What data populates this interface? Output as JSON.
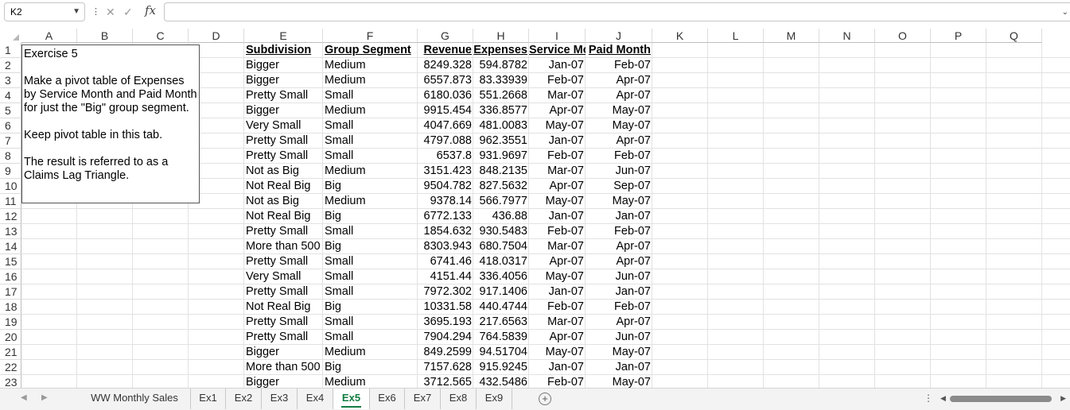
{
  "formula_bar": {
    "name_box": "K2",
    "formula": ""
  },
  "columns": [
    "A",
    "B",
    "C",
    "D",
    "E",
    "F",
    "G",
    "H",
    "I",
    "J",
    "K",
    "L",
    "M",
    "N",
    "O",
    "P",
    "Q"
  ],
  "row_numbers": [
    "1",
    "2",
    "3",
    "4",
    "5",
    "6",
    "7",
    "8",
    "9",
    "10",
    "11",
    "12",
    "13",
    "14",
    "15",
    "16",
    "17",
    "18",
    "19",
    "20",
    "21",
    "22",
    "23"
  ],
  "text_box": {
    "lines": [
      "Exercise 5",
      "",
      "Make a pivot table of Expenses",
      "by Service Month and Paid Month",
      "for just the \"Big\" group segment.",
      "",
      "Keep pivot table in this tab.",
      "",
      "The result is referred to as a",
      "Claims Lag Triangle."
    ]
  },
  "table": {
    "headers": [
      "Subdivision",
      "Group Segment",
      "Revenue",
      "Expenses",
      "Service Month",
      "Paid Month"
    ],
    "rows": [
      [
        "Bigger",
        "Medium",
        "8249.328",
        "594.8782",
        "Jan-07",
        "Feb-07"
      ],
      [
        "Bigger",
        "Medium",
        "6557.873",
        "83.33939",
        "Feb-07",
        "Apr-07"
      ],
      [
        "Pretty Small",
        "Small",
        "6180.036",
        "551.2668",
        "Mar-07",
        "Apr-07"
      ],
      [
        "Bigger",
        "Medium",
        "9915.454",
        "336.8577",
        "Apr-07",
        "May-07"
      ],
      [
        "Very Small",
        "Small",
        "4047.669",
        "481.0083",
        "May-07",
        "May-07"
      ],
      [
        "Pretty Small",
        "Small",
        "4797.088",
        "962.3551",
        "Jan-07",
        "Apr-07"
      ],
      [
        "Pretty Small",
        "Small",
        "6537.8",
        "931.9697",
        "Feb-07",
        "Feb-07"
      ],
      [
        "Not as Big",
        "Medium",
        "3151.423",
        "848.2135",
        "Mar-07",
        "Jun-07"
      ],
      [
        "Not Real Big",
        "Big",
        "9504.782",
        "827.5632",
        "Apr-07",
        "Sep-07"
      ],
      [
        "Not as Big",
        "Medium",
        "9378.14",
        "566.7977",
        "May-07",
        "May-07"
      ],
      [
        "Not Real Big",
        "Big",
        "6772.133",
        "436.88",
        "Jan-07",
        "Jan-07"
      ],
      [
        "Pretty Small",
        "Small",
        "1854.632",
        "930.5483",
        "Feb-07",
        "Feb-07"
      ],
      [
        "More than 500",
        "Big",
        "8303.943",
        "680.7504",
        "Mar-07",
        "Apr-07"
      ],
      [
        "Pretty Small",
        "Small",
        "6741.46",
        "418.0317",
        "Apr-07",
        "Apr-07"
      ],
      [
        "Very Small",
        "Small",
        "4151.44",
        "336.4056",
        "May-07",
        "Jun-07"
      ],
      [
        "Pretty Small",
        "Small",
        "7972.302",
        "917.1406",
        "Jan-07",
        "Jan-07"
      ],
      [
        "Not Real Big",
        "Big",
        "10331.58",
        "440.4744",
        "Feb-07",
        "Feb-07"
      ],
      [
        "Pretty Small",
        "Small",
        "3695.193",
        "217.6563",
        "Mar-07",
        "Apr-07"
      ],
      [
        "Pretty Small",
        "Small",
        "7904.294",
        "764.5839",
        "Apr-07",
        "Jun-07"
      ],
      [
        "Bigger",
        "Medium",
        "849.2599",
        "94.51704",
        "May-07",
        "May-07"
      ],
      [
        "More than 500",
        "Big",
        "7157.628",
        "915.9245",
        "Jan-07",
        "Jan-07"
      ],
      [
        "Bigger",
        "Medium",
        "3712.565",
        "432.5486",
        "Feb-07",
        "May-07"
      ]
    ]
  },
  "sheet_tabs": [
    {
      "label": "WW Monthly Sales",
      "active": false
    },
    {
      "label": "Ex1",
      "active": false
    },
    {
      "label": "Ex2",
      "active": false
    },
    {
      "label": "Ex3",
      "active": false
    },
    {
      "label": "Ex4",
      "active": false
    },
    {
      "label": "Ex5",
      "active": true
    },
    {
      "label": "Ex6",
      "active": false
    },
    {
      "label": "Ex7",
      "active": false
    },
    {
      "label": "Ex8",
      "active": false
    },
    {
      "label": "Ex9",
      "active": false
    }
  ],
  "icons": {
    "name_box_dropdown": "chevron-down-icon",
    "cancel": "cancel-icon",
    "enter": "check-icon",
    "function": "fx-icon",
    "add_sheet": "plus-icon"
  }
}
